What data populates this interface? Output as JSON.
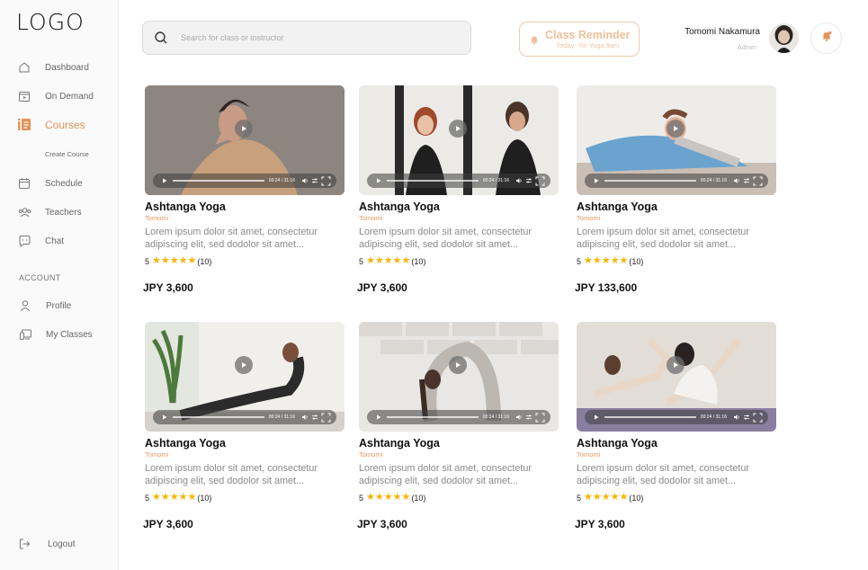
{
  "logo": "LOGO",
  "sidebar": {
    "items": [
      {
        "label": "Dashboard",
        "icon": "home-icon"
      },
      {
        "label": "On Demand",
        "icon": "calendar-play-icon"
      },
      {
        "label": "Courses",
        "icon": "courses-icon",
        "active": true
      },
      {
        "label": "Create Course",
        "icon": ""
      },
      {
        "label": "Schedule",
        "icon": "calendar-icon"
      },
      {
        "label": "Teachers",
        "icon": "users-icon"
      },
      {
        "label": "Chat",
        "icon": "chat-icon"
      }
    ],
    "account_label": "ACCOUNT",
    "account_items": [
      {
        "label": "Profile",
        "icon": "user-icon"
      },
      {
        "label": "My Classes",
        "icon": "classes-icon"
      }
    ],
    "logout": "Logout"
  },
  "search": {
    "placeholder": "Search for class or instructor"
  },
  "reminder": {
    "title": "Class Reminder",
    "subtitle": "Today: Yin Yoga 9am"
  },
  "user": {
    "name": "Tomomi Nakamura",
    "role": "Admin"
  },
  "accent_color": "#e2935a",
  "cards": [
    {
      "title": "Ashtanga Yoga",
      "instructor": "Tomomi",
      "desc": "Lorem ipsum dolor sit amet, consectetur adipiscing elit, sed dodolor sit amet...",
      "rating": "5",
      "reviews": "(10)",
      "price": "JPY 3,600",
      "time": "00:24 / 31:16"
    },
    {
      "title": "Ashtanga Yoga",
      "instructor": "Tomomi",
      "desc": "Lorem ipsum dolor sit amet, consectetur adipiscing elit, sed dodolor sit amet...",
      "rating": "5",
      "reviews": "(10)",
      "price": "JPY 3,600",
      "time": "00:24 / 31:16"
    },
    {
      "title": "Ashtanga Yoga",
      "instructor": "Tomomi",
      "desc": "Lorem ipsum dolor sit amet, consectetur adipiscing elit, sed dodolor sit amet...",
      "rating": "5",
      "reviews": "(10)",
      "price": "JPY 133,600",
      "time": "00:24 / 31:16"
    },
    {
      "title": "Ashtanga Yoga",
      "instructor": "Tomomi",
      "desc": "Lorem ipsum dolor sit amet, consectetur adipiscing elit, sed dodolor sit amet...",
      "rating": "5",
      "reviews": "(10)",
      "price": "JPY 3,600",
      "time": "00:24 / 31:16"
    },
    {
      "title": "Ashtanga Yoga",
      "instructor": "Tomomi",
      "desc": "Lorem ipsum dolor sit amet, consectetur adipiscing elit, sed dodolor sit amet...",
      "rating": "5",
      "reviews": "(10)",
      "price": "JPY 3,600",
      "time": "00:24 / 31:16"
    },
    {
      "title": "Ashtanga Yoga",
      "instructor": "Tomomi",
      "desc": "Lorem ipsum dolor sit amet, consectetur adipiscing elit, sed dodolor sit amet...",
      "rating": "5",
      "reviews": "(10)",
      "price": "JPY 3,600",
      "time": "00:24 / 31:16"
    }
  ]
}
